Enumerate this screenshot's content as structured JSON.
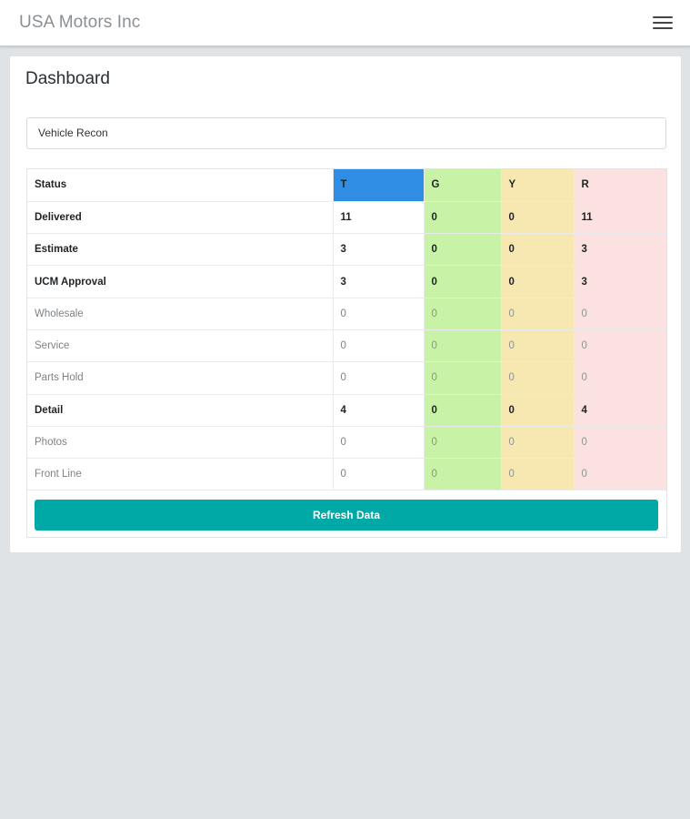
{
  "app": {
    "brand": "USA Motors Inc"
  },
  "dashboard": {
    "title": "Dashboard",
    "selected_view": "Vehicle Recon"
  },
  "table": {
    "headers": [
      "Status",
      "T",
      "G",
      "Y",
      "R"
    ],
    "rows": [
      {
        "status": "Delivered",
        "t": "11",
        "g": "0",
        "y": "0",
        "r": "11",
        "emphasis": true
      },
      {
        "status": "Estimate",
        "t": "3",
        "g": "0",
        "y": "0",
        "r": "3",
        "emphasis": true
      },
      {
        "status": "UCM Approval",
        "t": "3",
        "g": "0",
        "y": "0",
        "r": "3",
        "emphasis": true
      },
      {
        "status": "Wholesale",
        "t": "0",
        "g": "0",
        "y": "0",
        "r": "0",
        "emphasis": false
      },
      {
        "status": "Service",
        "t": "0",
        "g": "0",
        "y": "0",
        "r": "0",
        "emphasis": false
      },
      {
        "status": "Parts Hold",
        "t": "0",
        "g": "0",
        "y": "0",
        "r": "0",
        "emphasis": false
      },
      {
        "status": "Detail",
        "t": "4",
        "g": "0",
        "y": "0",
        "r": "4",
        "emphasis": true
      },
      {
        "status": "Photos",
        "t": "0",
        "g": "0",
        "y": "0",
        "r": "0",
        "emphasis": false
      },
      {
        "status": "Front Line",
        "t": "0",
        "g": "0",
        "y": "0",
        "r": "0",
        "emphasis": false
      }
    ]
  },
  "actions": {
    "refresh_label": "Refresh Data"
  },
  "colors": {
    "t_header": "#2f8de4",
    "green": "#c8f3a6",
    "yellow": "#f7e8b2",
    "red": "#fbe2e0",
    "refresh_button": "#00a9a5"
  },
  "icons": {
    "menu": "hamburger-menu-icon"
  }
}
